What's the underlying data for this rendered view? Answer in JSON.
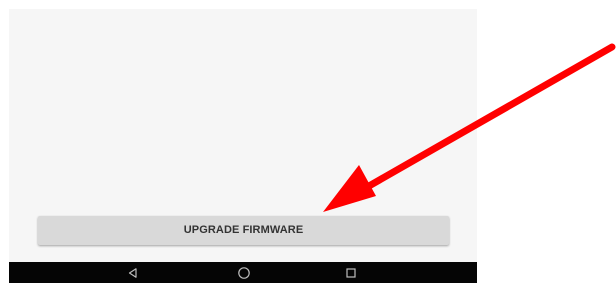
{
  "main": {
    "upgrade_button_label": "UPGRADE FIRMWARE"
  },
  "navigation_bar": {
    "items": [
      {
        "name": "back",
        "icon": "back-triangle-icon"
      },
      {
        "name": "home",
        "icon": "home-circle-icon"
      },
      {
        "name": "recents",
        "icon": "recents-square-icon"
      }
    ]
  },
  "annotation": {
    "arrow_color": "#ff0000",
    "arrow_target": "upgrade-firmware-button"
  },
  "colors": {
    "screen_background": "#f6f6f6",
    "button_background": "#d9d9d9",
    "navigation_bar": "#050505",
    "navigation_icons": "#bdbdbd"
  }
}
